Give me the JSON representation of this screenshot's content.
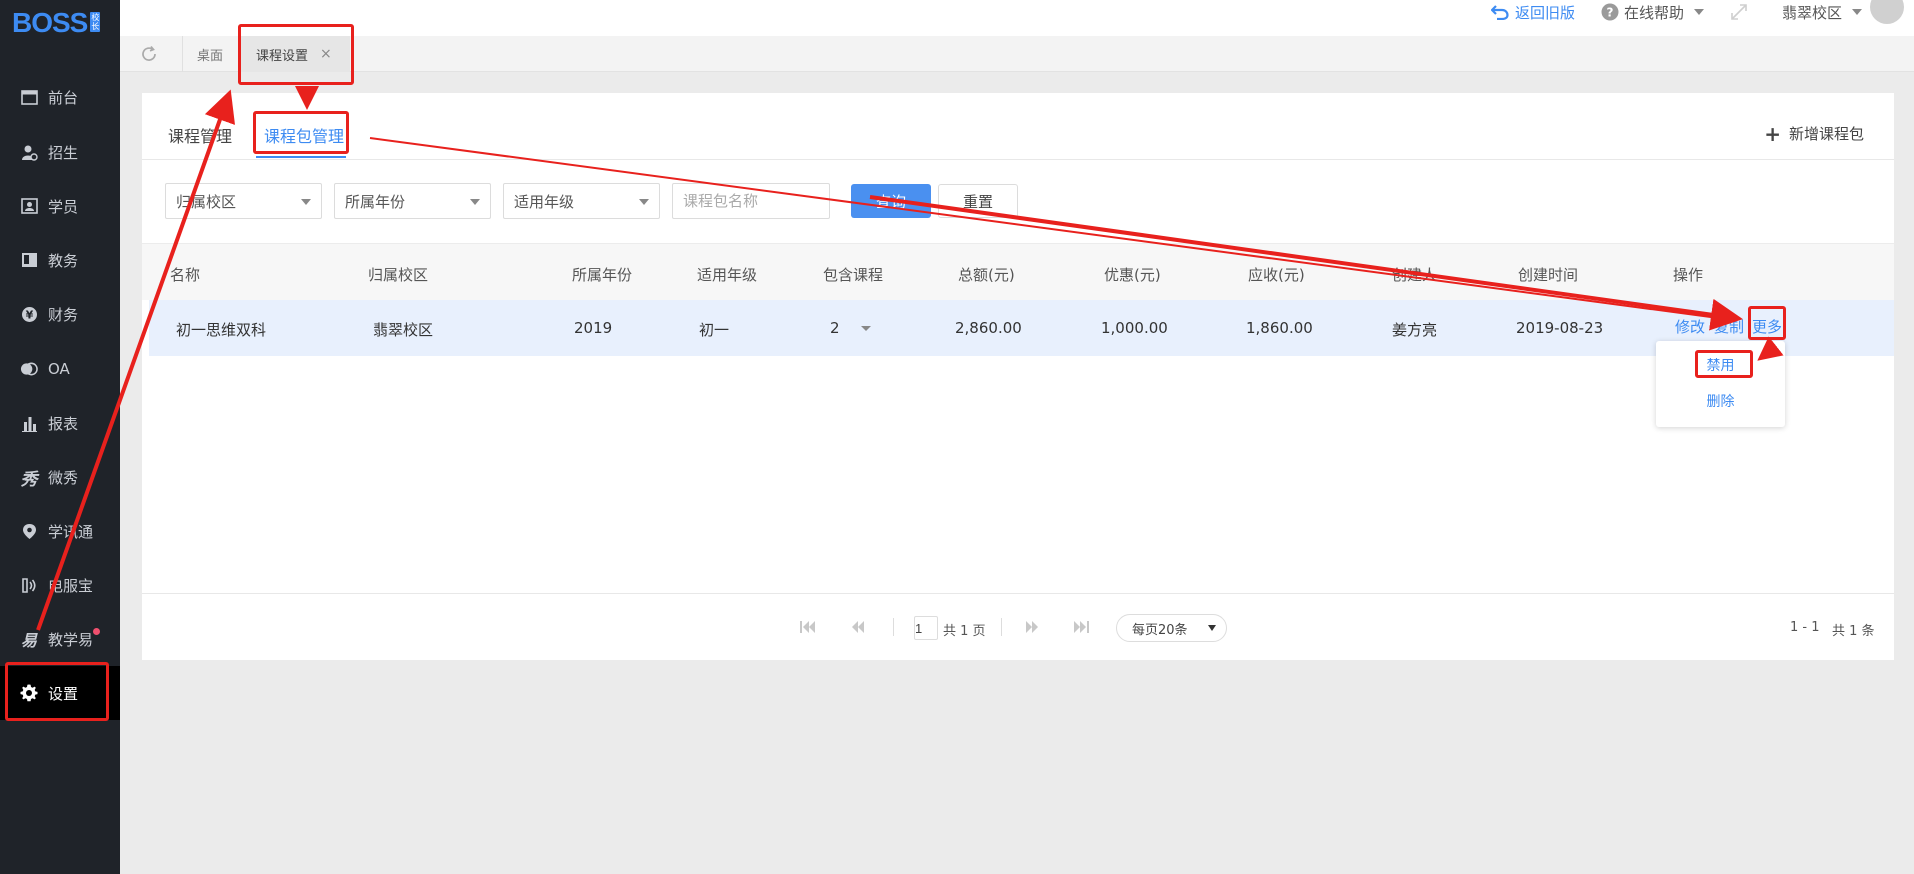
{
  "logo": {
    "text": "BOSS",
    "badge_top": "校",
    "badge_bottom": "长"
  },
  "sidebar": {
    "items": [
      {
        "label": "前台",
        "icon": "calendar-icon"
      },
      {
        "label": "招生",
        "icon": "user-plus-icon"
      },
      {
        "label": "学员",
        "icon": "id-card-icon"
      },
      {
        "label": "教务",
        "icon": "book-icon"
      },
      {
        "label": "财务",
        "icon": "yen-coin-icon"
      },
      {
        "label": "OA",
        "icon": "chat-bubbles-icon"
      },
      {
        "label": "报表",
        "icon": "bar-chart-icon"
      },
      {
        "label": "微秀",
        "icon": "xiu-icon"
      },
      {
        "label": "学讯通",
        "icon": "location-pin-icon"
      },
      {
        "label": "电服宝",
        "icon": "phone-wave-icon"
      },
      {
        "label": "教学易",
        "icon": "jiaoxueyi-icon"
      },
      {
        "label": "设置",
        "icon": "gear-icon"
      }
    ],
    "active": "设置"
  },
  "topbar": {
    "back_old": "返回旧版",
    "help": "在线帮助",
    "campus": "翡翠校区"
  },
  "tabs": {
    "desktop": "桌面",
    "current": "课程设置"
  },
  "subtabs": {
    "course_manage": "课程管理",
    "package_manage": "课程包管理"
  },
  "add_package": "新增课程包",
  "filters": {
    "campus": "归属校区",
    "year": "所属年份",
    "grade": "适用年级",
    "name_placeholder": "课程包名称",
    "query": "查询",
    "reset": "重置"
  },
  "table": {
    "headers": [
      "名称",
      "归属校区",
      "所属年份",
      "适用年级",
      "包含课程",
      "总额(元)",
      "优惠(元)",
      "应收(元)",
      "创建人",
      "创建时间",
      "操作"
    ],
    "rows": [
      {
        "name": "初一思维双科",
        "campus": "翡翠校区",
        "year": "2019",
        "grade": "初一",
        "courses": "2",
        "total": "2,860.00",
        "discount": "1,000.00",
        "receivable": "1,860.00",
        "creator": "姜方亮",
        "created": "2019-08-23",
        "actions": {
          "edit": "修改",
          "copy": "复制",
          "more": "更多"
        }
      }
    ]
  },
  "more_menu": {
    "disable": "禁用",
    "delete": "删除"
  },
  "pagination": {
    "page": "1",
    "total_pages": "共 1 页",
    "per_page": "每页20条",
    "range": "1 - 1",
    "total_items": "共 1 条"
  },
  "colors": {
    "accent": "#3d8bf2",
    "sidebar_bg": "#1f2329",
    "annotation": "#e8211d"
  }
}
